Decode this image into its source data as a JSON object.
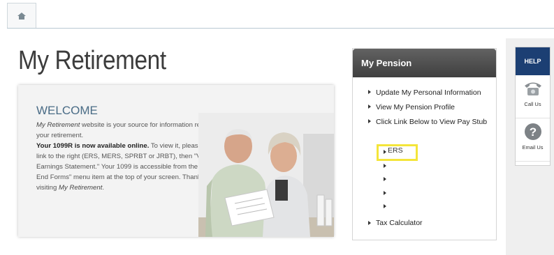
{
  "nav": {
    "home_icon": "home-icon"
  },
  "page": {
    "title": "My Retirement"
  },
  "welcome": {
    "heading": "WELCOME",
    "line1_em": "My Retirement",
    "line1_rest": " website is your source for information related to your retirement.",
    "line2_bold": "Your 1099R is now available online.",
    "line2_rest": " To view it, please click the link to the right (ERS, MERS, SPRBT or JRBT), then \"View Earnings Statement.\" Your 1099 is accessible from the \"Year End Forms\" menu item at the top of your screen. Thank you for visiting ",
    "line2_em": "My Retirement",
    "line2_end": "."
  },
  "pension": {
    "header": "My Pension",
    "items": [
      {
        "label": "Update My Personal Information"
      },
      {
        "label": "View My Pension Profile"
      },
      {
        "label": "Click Link Below to View Pay Stub"
      }
    ],
    "sub_items": [
      "ERS",
      "",
      "",
      "",
      ""
    ],
    "tax": "Tax Calculator"
  },
  "sidebar": {
    "help": "HELP",
    "call": {
      "label": "Call Us",
      "icon": "telephone-icon"
    },
    "email": {
      "label": "Email Us",
      "icon": "question-icon"
    }
  },
  "colors": {
    "help_bg": "#1c3f73",
    "highlight": "#f4e53a",
    "panel_header": "#4a4a4a"
  }
}
